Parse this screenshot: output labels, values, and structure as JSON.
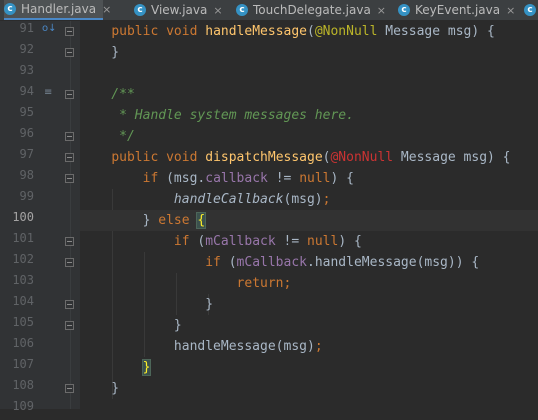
{
  "tabs": [
    {
      "label": "Handler.java",
      "icon": "class-c-icon",
      "active": true
    },
    {
      "label": "View.java",
      "icon": "class-c-icon",
      "active": false
    },
    {
      "label": "TouchDelegate.java",
      "icon": "class-c-icon",
      "active": false
    },
    {
      "label": "KeyEvent.java",
      "icon": "class-c-icon",
      "active": false
    }
  ],
  "tab_icon_letter": "c",
  "tab_close_glyph": "×",
  "gutter": {
    "line_numbers": [
      "91",
      "92",
      "93",
      "94",
      "95",
      "96",
      "97",
      "98",
      "99",
      "100",
      "101",
      "102",
      "103",
      "104",
      "105",
      "106",
      "107",
      "108",
      "109"
    ],
    "current_line": "100"
  },
  "code_lines": {
    "l91": [
      {
        "t": "    "
      },
      {
        "t": "public",
        "c": "kw"
      },
      {
        "t": " "
      },
      {
        "t": "void",
        "c": "kw"
      },
      {
        "t": " "
      },
      {
        "t": "handleMessage",
        "c": "fn"
      },
      {
        "t": "("
      },
      {
        "t": "@NonNull",
        "c": "ann"
      },
      {
        "t": " Message msg) {"
      }
    ],
    "l92": [
      {
        "t": "    }"
      }
    ],
    "l93": [
      {
        "t": ""
      }
    ],
    "l94": [
      {
        "t": "    /**",
        "c": "doc"
      }
    ],
    "l95": [
      {
        "t": "     * Handle system messages here.",
        "c": "doc"
      }
    ],
    "l96": [
      {
        "t": "     */",
        "c": "doc"
      }
    ],
    "l97": [
      {
        "t": "    "
      },
      {
        "t": "public",
        "c": "kw"
      },
      {
        "t": " "
      },
      {
        "t": "void",
        "c": "kw"
      },
      {
        "t": " "
      },
      {
        "t": "dispatchMessage",
        "c": "fn"
      },
      {
        "t": "("
      },
      {
        "t": "@NonNull",
        "c": "annarg"
      },
      {
        "t": " Message msg) {"
      }
    ],
    "l98": [
      {
        "t": "        "
      },
      {
        "t": "if",
        "c": "kw"
      },
      {
        "t": " (msg."
      },
      {
        "t": "callback",
        "c": "fld"
      },
      {
        "t": " != "
      },
      {
        "t": "null",
        "c": "kw"
      },
      {
        "t": ") {"
      }
    ],
    "l99": [
      {
        "t": "            "
      },
      {
        "t": "handleCallback",
        "c": "it"
      },
      {
        "t": "(msg)"
      },
      {
        "t": ";",
        "c": "kw"
      }
    ],
    "l100": [
      {
        "t": "        } "
      },
      {
        "t": "else",
        "c": "kw"
      },
      {
        "t": " "
      },
      {
        "t": "{",
        "c": "brace-hl"
      }
    ],
    "l101": [
      {
        "t": "            "
      },
      {
        "t": "if",
        "c": "kw"
      },
      {
        "t": " ("
      },
      {
        "t": "mCallback",
        "c": "fld"
      },
      {
        "t": " != "
      },
      {
        "t": "null",
        "c": "kw"
      },
      {
        "t": ") {"
      }
    ],
    "l102": [
      {
        "t": "                "
      },
      {
        "t": "if",
        "c": "kw"
      },
      {
        "t": " ("
      },
      {
        "t": "mCallback",
        "c": "fld"
      },
      {
        "t": ".handleMessage(msg)) {"
      }
    ],
    "l103": [
      {
        "t": "                    "
      },
      {
        "t": "return",
        "c": "kw"
      },
      {
        "t": ";",
        "c": "kw"
      }
    ],
    "l104": [
      {
        "t": "                }"
      }
    ],
    "l105": [
      {
        "t": "            }"
      }
    ],
    "l106": [
      {
        "t": "            handleMessage(msg)"
      },
      {
        "t": ";",
        "c": "kw"
      }
    ],
    "l107": [
      {
        "t": "        "
      },
      {
        "t": "}",
        "c": "brace-hl"
      }
    ],
    "l108": [
      {
        "t": "    }"
      }
    ],
    "l109": [
      {
        "t": ""
      }
    ]
  },
  "colors": {
    "editor_bg": "#2b2b2b",
    "gutter_bg": "#313335",
    "keyword": "#cc7832",
    "annotation": "#bbb529",
    "method_decl": "#ffc66d",
    "field": "#9876aa",
    "doc_comment": "#629755",
    "plain": "#a9b7c6",
    "brace_match": "#ffef28"
  }
}
